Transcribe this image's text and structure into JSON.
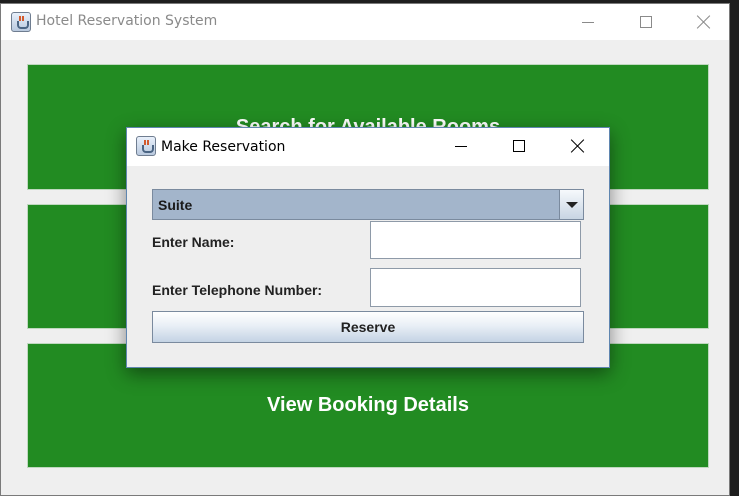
{
  "main_window": {
    "title": "Hotel Reservation System",
    "buttons": [
      {
        "label": "Search for Available Rooms"
      },
      {
        "label": ""
      },
      {
        "label": "View Booking Details"
      }
    ]
  },
  "dialog": {
    "title": "Make Reservation",
    "room_type": {
      "selected": "Suite"
    },
    "name_field": {
      "label": "Enter Name:",
      "value": ""
    },
    "phone_field": {
      "label": "Enter Telephone Number:",
      "value": ""
    },
    "reserve_label": "Reserve"
  },
  "colors": {
    "action_green": "#228b22",
    "combo_blue": "#a3b5cb",
    "background": "#efefef"
  }
}
